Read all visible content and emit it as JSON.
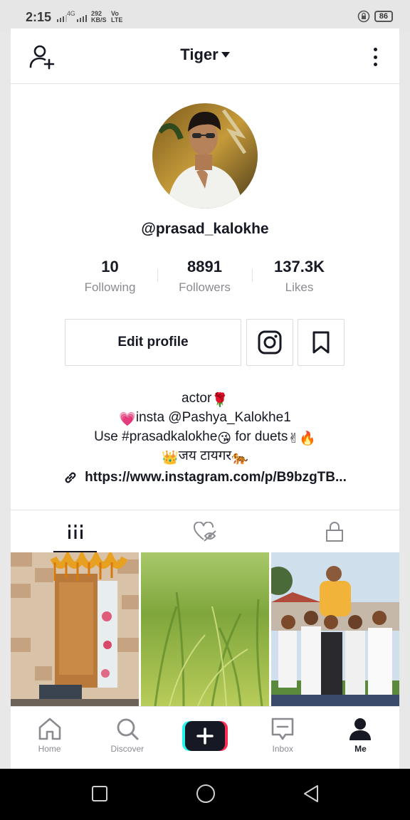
{
  "status_bar": {
    "time": "2:15",
    "network": "4G",
    "speed_value": "292",
    "speed_unit": "KB/S",
    "volte_top": "Vo",
    "volte_bottom": "LTE",
    "battery": "86"
  },
  "header": {
    "title": "Tiger",
    "add_user_icon": "add-user-icon",
    "more_icon": "more-vertical-icon"
  },
  "profile": {
    "username": "@prasad_kalokhe",
    "stats": [
      {
        "value": "10",
        "label": "Following"
      },
      {
        "value": "8891",
        "label": "Followers"
      },
      {
        "value": "137.3K",
        "label": "Likes"
      }
    ],
    "edit_label": "Edit profile",
    "bio": {
      "line1": "actor",
      "line1_emoji": "🌹",
      "line2_emoji": "💗",
      "line2": "insta @Pashya_Kalokhe1",
      "line3_a": "Use #prasadkalokhe",
      "line3_emoji1": "😘",
      "line3_b": " for duets",
      "line3_emoji2": "✌",
      "line3_emoji3": "🔥",
      "line4_emoji1": "👑",
      "line4": "जय टायगर",
      "line4_emoji2": "🐅"
    },
    "link": "https://www.instagram.com/p/B9bzgTB..."
  },
  "tabs": [
    {
      "name": "videos",
      "icon": "grid-icon",
      "active": true
    },
    {
      "name": "liked",
      "icon": "liked-hidden-icon",
      "active": false
    },
    {
      "name": "private",
      "icon": "lock-icon",
      "active": false
    }
  ],
  "videos": [
    {
      "name": "video-1",
      "scene": "doorway"
    },
    {
      "name": "video-2",
      "scene": "grass"
    },
    {
      "name": "video-3",
      "scene": "group"
    }
  ],
  "tabbar": [
    {
      "label": "Home",
      "icon": "home-icon",
      "active": false
    },
    {
      "label": "Discover",
      "icon": "search-icon",
      "active": false
    },
    {
      "label": "",
      "icon": "plus-icon",
      "active": false
    },
    {
      "label": "Inbox",
      "icon": "inbox-icon",
      "active": false
    },
    {
      "label": "Me",
      "icon": "profile-icon",
      "active": true
    }
  ],
  "colors": {
    "text_primary": "#161823",
    "text_secondary": "#8a8b91",
    "create_cyan": "#25f4ee",
    "create_red": "#fe2c55"
  }
}
